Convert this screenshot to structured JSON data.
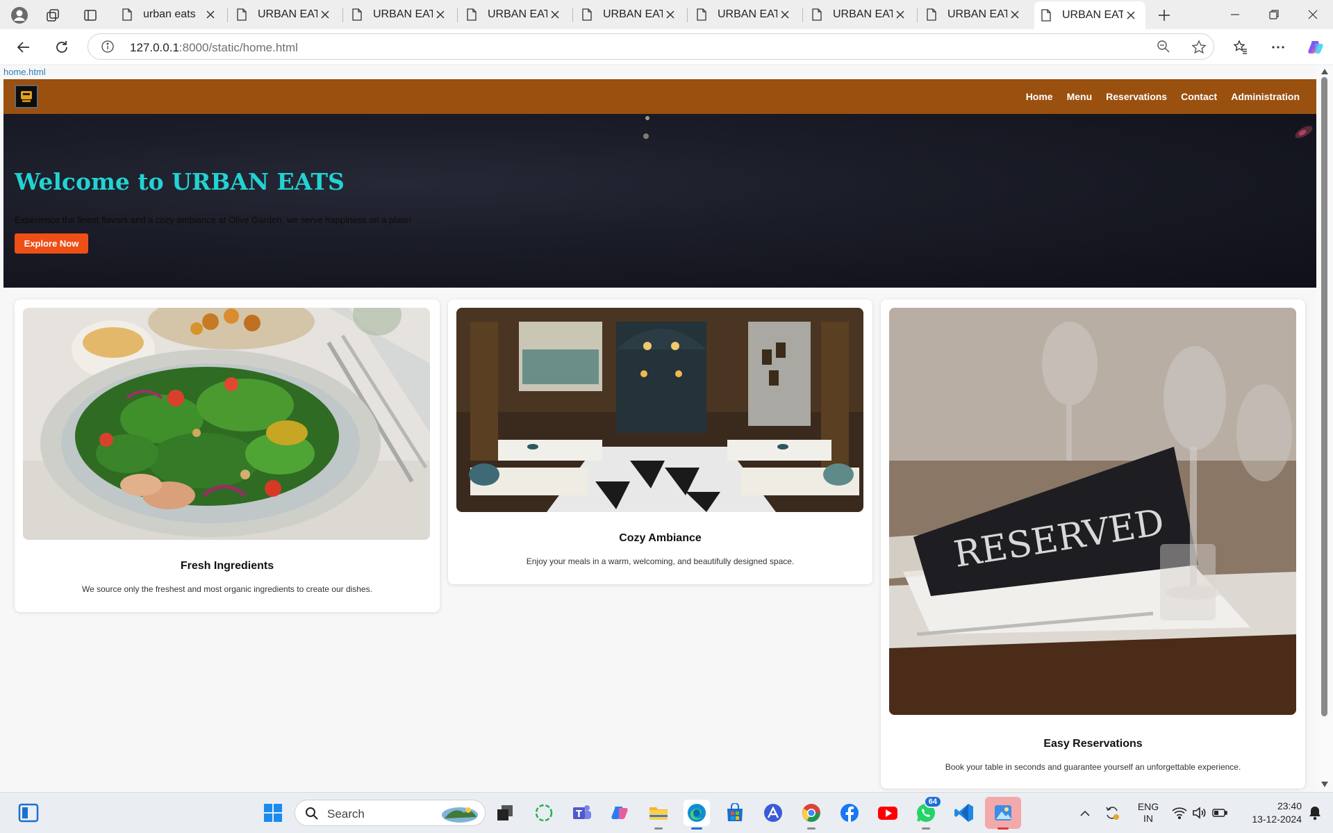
{
  "browser": {
    "tabs": [
      {
        "title": "urban eats",
        "active": false
      },
      {
        "title": "URBAN EATS",
        "active": false
      },
      {
        "title": "URBAN EATS",
        "active": false
      },
      {
        "title": "URBAN EATS",
        "active": false
      },
      {
        "title": "URBAN EATS",
        "active": false
      },
      {
        "title": "URBAN EATS",
        "active": false
      },
      {
        "title": "URBAN EATS",
        "active": false
      },
      {
        "title": "URBAN EATS",
        "active": false
      },
      {
        "title": "URBAN EATS",
        "active": true
      }
    ],
    "url_host": "127.0.0.1",
    "url_path": ":8000/static/home.html"
  },
  "page": {
    "broken_image_alt": "home.html",
    "nav": {
      "links": [
        "Home",
        "Menu",
        "Reservations",
        "Contact",
        "Administration"
      ]
    },
    "hero": {
      "title": "Welcome to URBAN EATS",
      "subtitle": "Experience the finest flavors and a cozy ambiance at Olive Garden, we serve happiness on a plate!",
      "button": "Explore Now"
    },
    "features": [
      {
        "title": "Fresh Ingredients",
        "text": "We source only the freshest and most organic ingredients to create our dishes."
      },
      {
        "title": "Cozy Ambiance",
        "text": "Enjoy your meals in a warm, welcoming, and beautifully designed space."
      },
      {
        "title": "Easy Reservations",
        "text": "Book your table in seconds and guarantee yourself an unforgettable experience."
      }
    ],
    "reserved_sign": "RESERVED"
  },
  "taskbar": {
    "search_label": "Search",
    "whatsapp_badge": "64",
    "lang_line1": "ENG",
    "lang_line2": "IN",
    "time": "23:40",
    "date": "13-12-2024"
  },
  "colors": {
    "nav_bg": "#9a500f",
    "hero_title": "#22d3d3",
    "hero_button": "#ee4f17"
  }
}
